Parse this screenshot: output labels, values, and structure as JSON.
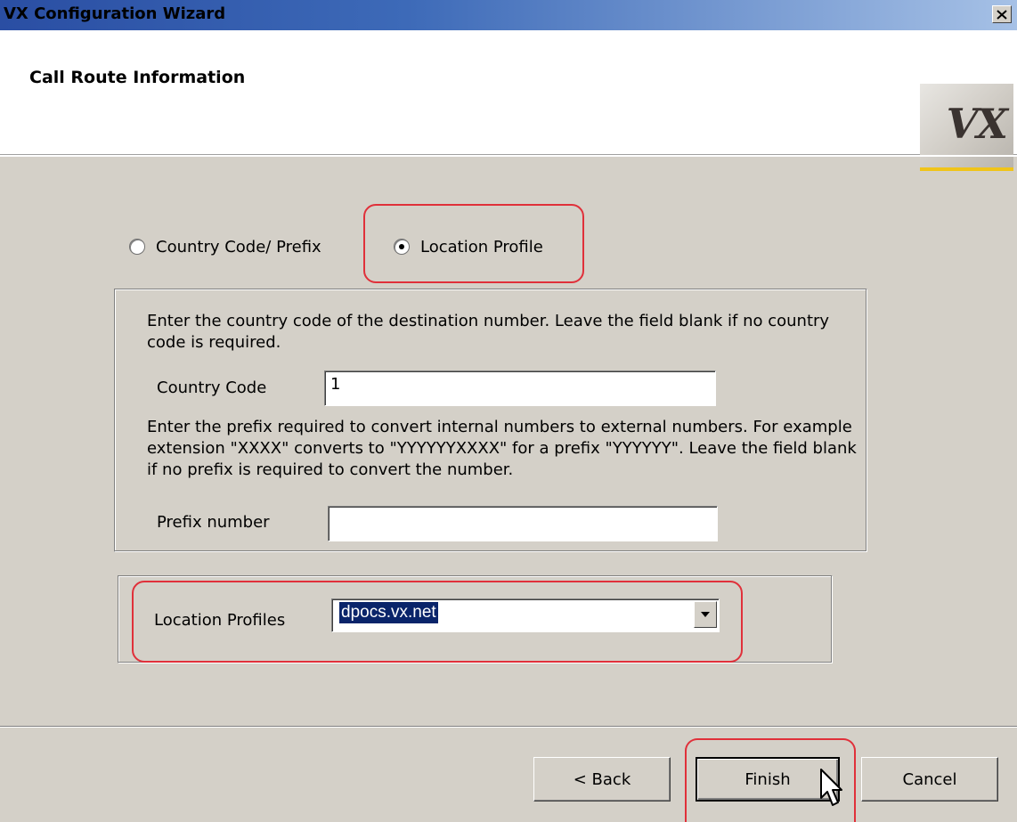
{
  "window": {
    "title": "VX Configuration Wizard"
  },
  "header": {
    "title": "Call Route Information",
    "logo_text": "VX"
  },
  "route_type": {
    "options": [
      {
        "label": "Country Code/ Prefix",
        "checked": false
      },
      {
        "label": "Location Profile",
        "checked": true
      }
    ]
  },
  "country_group": {
    "country_help": "Enter the country code of the destination number. Leave the field blank if no country code is required.",
    "country_label": "Country Code",
    "country_value": "1",
    "prefix_help": "Enter the prefix required to convert internal numbers to external numbers. For example extension \"XXXX\" converts to \"YYYYYYXXXX\" for a prefix \"YYYYYY\". Leave the field blank if no prefix is required to convert the number.",
    "prefix_label": "Prefix number",
    "prefix_value": ""
  },
  "location_group": {
    "label": "Location Profiles",
    "selected": "dpocs.vx.net"
  },
  "footer": {
    "back_label": "< Back",
    "finish_label": "Finish",
    "cancel_label": "Cancel"
  },
  "colors": {
    "highlight": "#e0303a",
    "selection": "#0a246a",
    "dialog_bg": "#d4d0c8"
  }
}
